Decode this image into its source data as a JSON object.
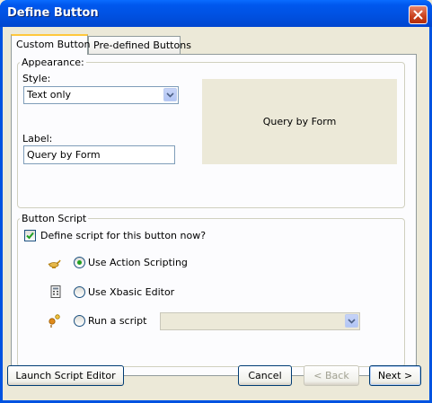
{
  "window": {
    "title": "Define Button"
  },
  "tabs": [
    {
      "label": "Custom Button",
      "active": true
    },
    {
      "label": "Pre-defined Buttons",
      "active": false
    }
  ],
  "appearance": {
    "group_title": "Appearance:",
    "style_label": "Style:",
    "style_value": "Text only",
    "label_label": "Label:",
    "label_value": "Query by Form",
    "preview_text": "Query by Form"
  },
  "script": {
    "group_title": "Button Script",
    "define_checkbox_label": "Define script for this button now?",
    "define_checked": true,
    "options": [
      {
        "label": "Use Action Scripting",
        "selected": true,
        "icon": "genie-lamp-icon"
      },
      {
        "label": "Use Xbasic Editor",
        "selected": false,
        "icon": "calculator-icon"
      },
      {
        "label": "Run a script",
        "selected": false,
        "icon": "script-run-icon"
      }
    ],
    "run_script_value": ""
  },
  "buttons": {
    "launch": "Launch Script Editor",
    "cancel": "Cancel",
    "back": "< Back",
    "next": "Next >"
  }
}
